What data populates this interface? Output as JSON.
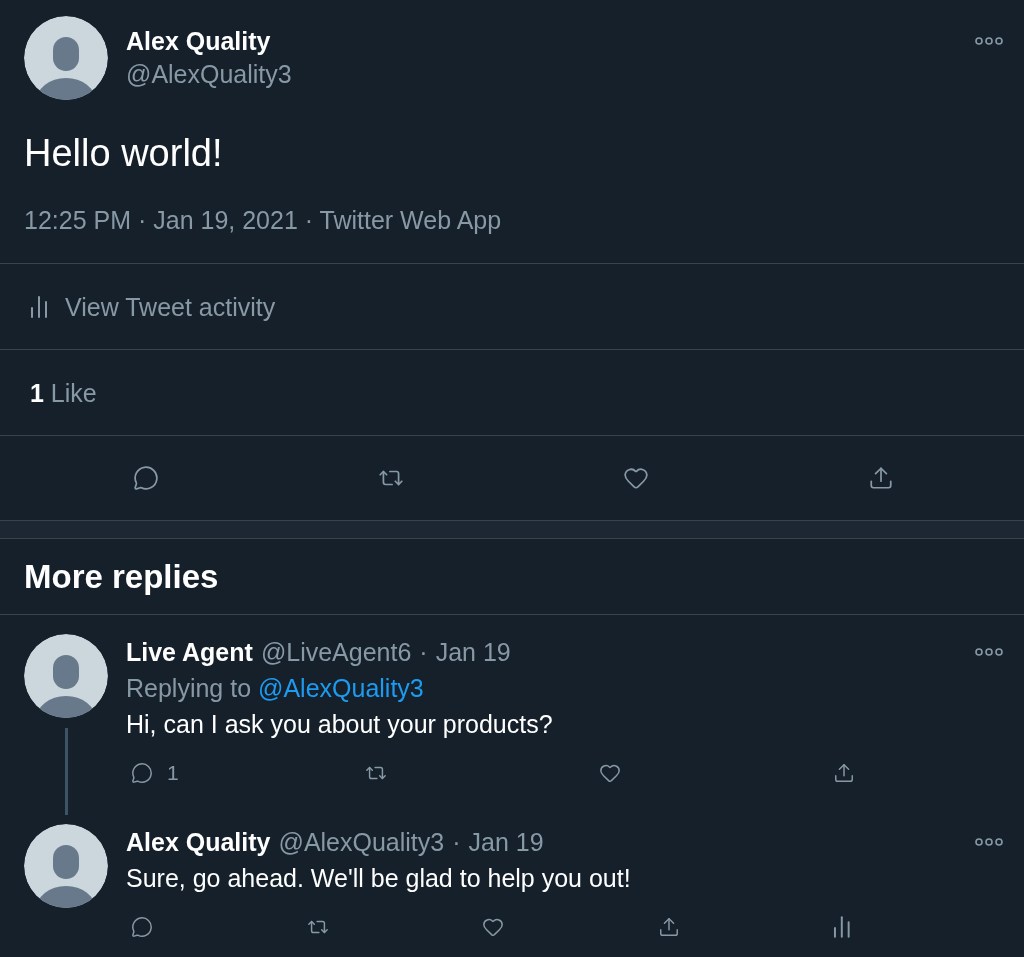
{
  "tweet": {
    "author": {
      "name": "Alex Quality",
      "handle": "@AlexQuality3"
    },
    "text": "Hello world!",
    "meta": "12:25 PM · Jan 19, 2021 · Twitter Web App",
    "activity": {
      "label": "View Tweet activity"
    },
    "likes": {
      "count": "1",
      "label": "Like"
    },
    "actions": [
      {
        "kind": "reply"
      },
      {
        "kind": "retweet"
      },
      {
        "kind": "like"
      },
      {
        "kind": "share"
      }
    ]
  },
  "more_replies": {
    "title": "More replies"
  },
  "replies": [
    {
      "name": "Live Agent",
      "handle": "@LiveAgent6",
      "separator": "·",
      "date": "Jan 19",
      "replying_to": {
        "label": "Replying to",
        "handle": "@AlexQuality3"
      },
      "text": "Hi, can I ask you about your products?",
      "thread_continues": true,
      "actions": [
        {
          "kind": "reply",
          "count": "1"
        },
        {
          "kind": "retweet"
        },
        {
          "kind": "like"
        },
        {
          "kind": "share"
        }
      ]
    },
    {
      "name": "Alex Quality",
      "handle": "@AlexQuality3",
      "separator": "·",
      "date": "Jan 19",
      "text": "Sure, go ahead. We'll be glad to help you out!",
      "thread_continues": false,
      "actions": [
        {
          "kind": "reply"
        },
        {
          "kind": "retweet"
        },
        {
          "kind": "like"
        },
        {
          "kind": "share"
        },
        {
          "kind": "analytics"
        }
      ]
    }
  ]
}
